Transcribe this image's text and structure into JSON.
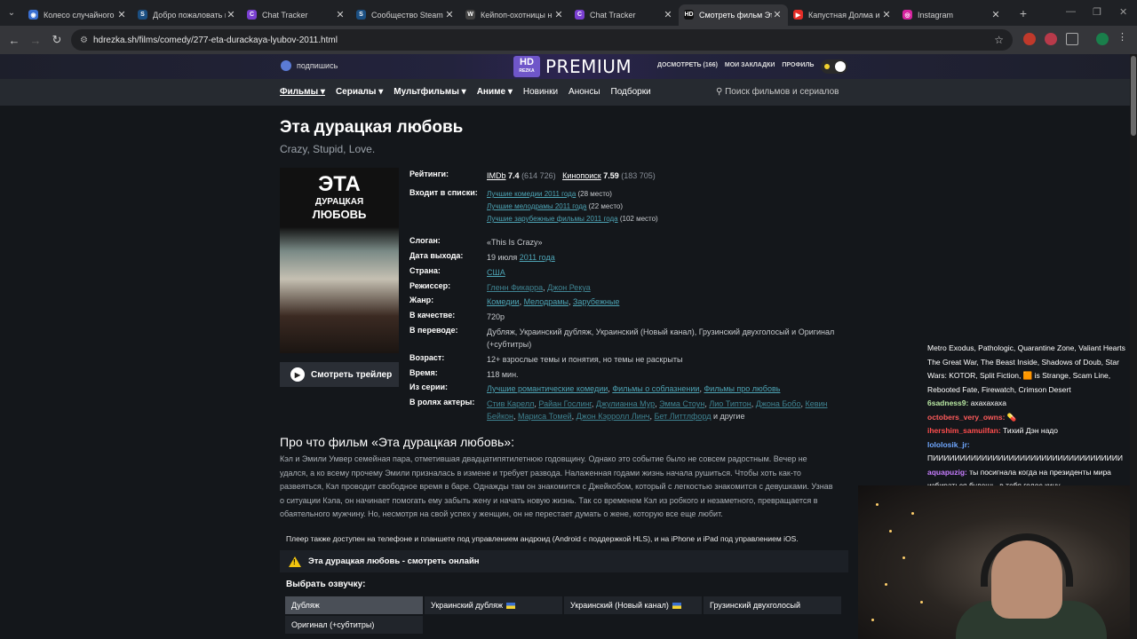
{
  "browser": {
    "tabs": [
      {
        "title": "Колесо случайного в",
        "color": "#3a6fd1",
        "glyph": "◉"
      },
      {
        "title": "Добро пожаловать в",
        "color": "#1b4f82",
        "glyph": "S"
      },
      {
        "title": "Chat Tracker",
        "color": "#7a3fd1",
        "glyph": "C"
      },
      {
        "title": "Сообщество Steam :",
        "color": "#1b4f82",
        "glyph": "S"
      },
      {
        "title": "Кейпоп-охотницы н",
        "color": "#444",
        "glyph": "W"
      },
      {
        "title": "Chat Tracker",
        "color": "#7a3fd1",
        "glyph": "C"
      },
      {
        "title": "Смотреть фильм Эт",
        "color": "#111",
        "glyph": "HD",
        "active": true
      },
      {
        "title": "Капустная Долма и п",
        "color": "#e52d27",
        "glyph": "▶"
      },
      {
        "title": "Instagram",
        "color": "#d6249f",
        "glyph": "◎"
      }
    ],
    "url": "hdrezka.sh/films/comedy/277-eta-durackaya-lyubov-2011.html"
  },
  "site": {
    "subscribe": "подпишись",
    "logo_hd": "HD",
    "logo_sub": "REZKA",
    "premium": "PREMIUM",
    "toplinks": {
      "watch": "ДОСМОТРЕТЬ",
      "watch_count": "166",
      "bookmarks": "МОИ ЗАКЛАДКИ",
      "profile": "ПРОФИЛЬ"
    },
    "nav": [
      "Фильмы",
      "Сериалы",
      "Мультфильмы",
      "Аниме",
      "Новинки",
      "Анонсы",
      "Подборки"
    ],
    "search_placeholder": "Поиск фильмов и сериалов"
  },
  "movie": {
    "title": "Эта дурацкая любовь",
    "original_title": "Crazy, Stupid, Love.",
    "poster": {
      "line1": "ЭТА",
      "line2": "ДУРАЦКАЯ",
      "line3": "ЛЮБОВЬ"
    },
    "trailer_button": "Смотреть трейлер",
    "labels": {
      "ratings": "Рейтинги:",
      "lists": "Входит в списки:",
      "slogan": "Слоган:",
      "release": "Дата выхода:",
      "country": "Страна:",
      "director": "Режиссер:",
      "genre": "Жанр:",
      "quality": "В качестве:",
      "translation": "В переводе:",
      "age": "Возраст:",
      "time": "Время:",
      "series": "Из серии:",
      "actors": "В ролях актеры:"
    },
    "ratings": {
      "imdb_label": "IMDb",
      "imdb": "7.4",
      "imdb_votes": "(614 726)",
      "kp_label": "Кинопоиск",
      "kp": "7.59",
      "kp_votes": "(183 705)"
    },
    "lists": [
      {
        "name": "Лучшие комедии 2011 года",
        "place": "(28 место)"
      },
      {
        "name": "Лучшие мелодрамы 2011 года",
        "place": "(22 место)"
      },
      {
        "name": "Лучшие зарубежные фильмы 2011 года",
        "place": "(102 место)"
      }
    ],
    "slogan": "«This Is Crazy»",
    "release_day": "19 июля",
    "release_year": "2011 года",
    "country": "США",
    "director1": "Гленн Фикарра",
    "director2": "Джон Рекуа",
    "genres": [
      "Комедии",
      "Мелодрамы",
      "Зарубежные"
    ],
    "quality": "720p",
    "translation": "Дубляж, Украинский дубляж, Украинский (Новый канал), Грузинский двухголосый и Оригинал (+субтитры)",
    "age": "12+ взрослые темы и понятия, но темы не раскрыты",
    "time": "118 мин.",
    "series": [
      "Лучшие романтические комедии",
      "Фильмы о соблазнении",
      "Фильмы про любовь"
    ],
    "actors": [
      "Стив Карелл",
      "Райан Гослинг",
      "Джулианна Мур",
      "Эмма Стоун",
      "Лио Типтон",
      "Джона Бобо",
      "Кевин Бейкон",
      "Мариса Томей",
      "Джон Кэрролл Линч",
      "Бет Литтлфорд"
    ],
    "actors_more": "и другие",
    "about_title": "Про что фильм «Эта дурацкая любовь»:",
    "description": "Кэл и Эмили Умвер семейная пара, отметившая двадцатипятилетнюю годовщину. Однако это событие было не совсем радостным. Вечер не удался, а ко всему прочему Эмили призналась в измене и требует развода. Налаженная годами жизнь начала рушиться. Чтобы хоть как-то развеяться, Кэл проводит свободное время в баре. Однажды там он знакомится с Джейкобом, который с легкостью знакомится с девушками. Узнав о ситуации Кэла, он начинает помогать ему забыть жену и начать новую жизнь. Так со временем Кэл из робкого и незаметного, превращается в обаятельного мужчину. Но, несмотря на свой успех у женщин, он не перестает думать о жене, которую все еще любит.",
    "player_note": "Плеер также доступен на телефоне и планшете под управлением андроид (Android с поддержкой HLS), и на iPhone и iPad под управлением iOS.",
    "watch_online": "Эта дурацкая любовь - смотреть онлайн",
    "choose_voice": "Выбрать озвучку:",
    "voices": [
      "Дубляж",
      "Украинский дубляж",
      "Украинский (Новый канал)",
      "Грузинский двухголосый",
      "Оригинал (+субтитры)"
    ]
  },
  "chat": {
    "lines": [
      {
        "user": "",
        "text": "Metro Exodus, Pathologic, Quarantine Zone, Valiant Hearts The Great War, The Beast Inside, Shadows of Doub, Star Wars: KOTOR, Split Fiction, 🟧 is Strange, Scam Line, Rebooted Fate, Firewatch, Crimson Desert"
      },
      {
        "user": "6sadness9:",
        "text": "ахахахаха"
      },
      {
        "user": "octobers_very_owns:",
        "text": "💊"
      },
      {
        "user": "ihershim_samuilfan:",
        "text": "Тихий Дэн надо"
      },
      {
        "user": "lololosik_jr:",
        "text": "ПИИИИИИИИИИИИИИИИИИИИИИИИИИИИИИИИИИИ"
      },
      {
        "user": "aquapuzig:",
        "text": "ты посигнала когда на президенты мира избираться будешь, в тебя голос кину"
      }
    ]
  }
}
